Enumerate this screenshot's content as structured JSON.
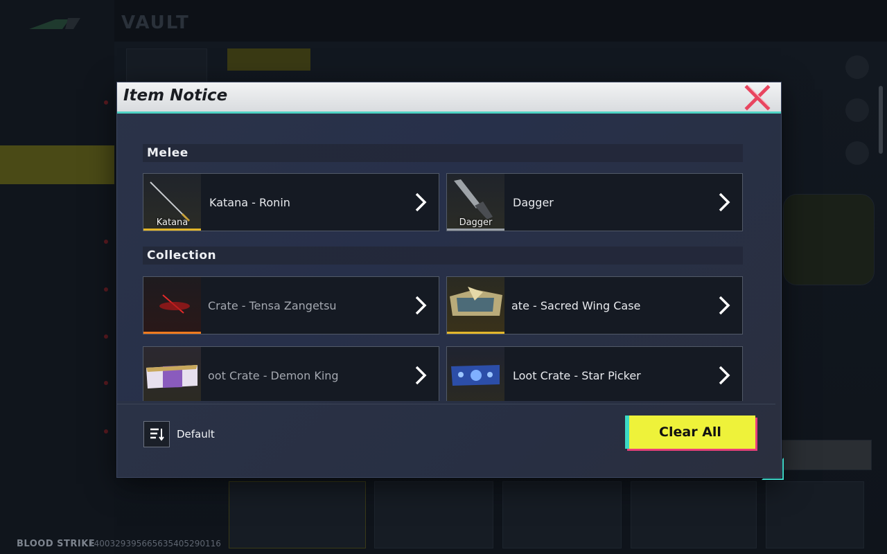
{
  "background": {
    "vault_label": "VAULT",
    "footer_brand": "BLOOD STRIKE",
    "footer_id": "14003293956656354052901​16"
  },
  "modal": {
    "title": "Item Notice",
    "sections": [
      {
        "label": "Melee"
      },
      {
        "label": "Collection"
      }
    ],
    "items": [
      {
        "name": "Katana - Ronin",
        "thumb_label": "Katana",
        "rarity_color": "#e3b62b",
        "icon": "katana-icon"
      },
      {
        "name": "Dagger",
        "thumb_label": "Dagger",
        "rarity_color": "#9aa0a8",
        "icon": "dagger-icon"
      },
      {
        "name": "Crate - Tensa Zangetsu",
        "thumb_label": "",
        "rarity_color": "#f07a1e",
        "icon": "tensa-zangetsu-crate-icon"
      },
      {
        "name": "ate - Sacred Wing Case",
        "thumb_label": "",
        "rarity_color": "#e3b62b",
        "icon": "sacred-wing-case-icon"
      },
      {
        "name": "oot Crate - Demon King",
        "thumb_label": "",
        "rarity_color": "#e3b62b",
        "icon": "demon-king-crate-icon"
      },
      {
        "name": "Loot Crate - Star Picker",
        "thumb_label": "",
        "rarity_color": "#e3b62b",
        "icon": "star-picker-crate-icon"
      }
    ],
    "sort_label": "Default",
    "clear_all_label": "Clear All"
  },
  "colors": {
    "accent_yellow": "#eef23a",
    "accent_teal": "#4fd3c4",
    "close_red": "#e8455f"
  }
}
